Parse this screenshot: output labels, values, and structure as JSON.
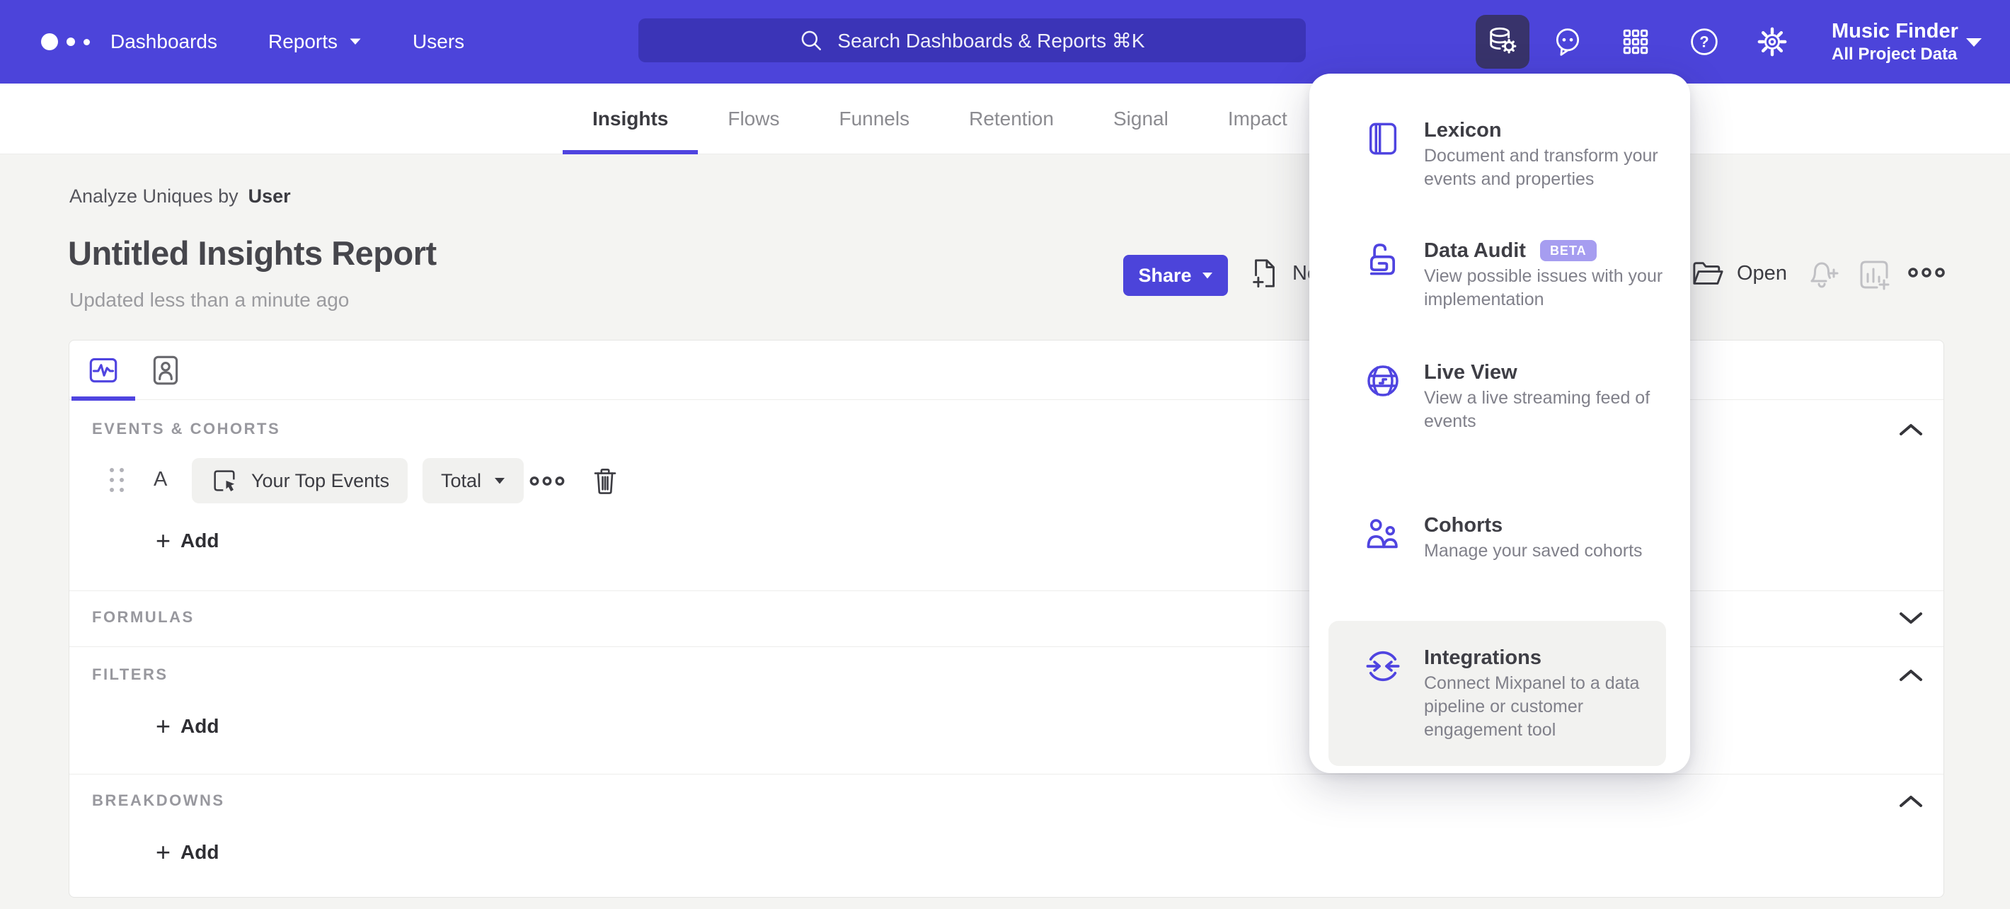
{
  "nav": {
    "items": [
      {
        "label": "Dashboards"
      },
      {
        "label": "Reports"
      },
      {
        "label": "Users"
      }
    ],
    "search_placeholder": "Search Dashboards & Reports ⌘K",
    "project": {
      "name": "Music Finder",
      "scope": "All Project Data"
    },
    "icons": [
      "mixpanel-logo",
      "search-icon",
      "data-management-icon",
      "feedback-icon",
      "apps-grid-icon",
      "help-icon",
      "settings-gear-icon",
      "caret-down-icon"
    ]
  },
  "tabs": {
    "items": [
      {
        "label": "Insights",
        "active": true
      },
      {
        "label": "Flows",
        "active": false
      },
      {
        "label": "Funnels",
        "active": false
      },
      {
        "label": "Retention",
        "active": false
      },
      {
        "label": "Signal",
        "active": false
      },
      {
        "label": "Impact",
        "active": false
      }
    ]
  },
  "report": {
    "analyze_prefix": "Analyze Uniques by",
    "analyze_entity": "User",
    "title": "Untitled Insights Report",
    "updated": "Updated less than a minute ago",
    "share_label": "Share",
    "new_label": "New",
    "open_label": "Open"
  },
  "builder": {
    "events": {
      "label": "EVENTS & COHORTS",
      "row": {
        "letter": "A",
        "event": "Your Top Events",
        "metric": "Total"
      },
      "add_label": "Add"
    },
    "formulas": {
      "label": "FORMULAS"
    },
    "filters": {
      "label": "FILTERS",
      "add_label": "Add"
    },
    "breakdowns": {
      "label": "BREAKDOWNS",
      "add_label": "Add"
    }
  },
  "menu": {
    "items": [
      {
        "title": "Lexicon",
        "desc": "Document and transform your events and properties"
      },
      {
        "title": "Data Audit",
        "badge": "BETA",
        "desc": "View possible issues with your implementation"
      },
      {
        "title": "Live View",
        "desc": "View a live streaming feed of events"
      },
      {
        "title": "Cohorts",
        "desc": "Manage your saved cohorts"
      },
      {
        "title": "Integrations",
        "desc": "Connect Mixpanel to a data pipeline or customer engagement tool",
        "highlighted": true
      }
    ]
  },
  "colors": {
    "nav_purple": "#4c44da",
    "accent_purple": "#4f44e0",
    "active_tile": "#38336b",
    "beta_badge": "#a69df0",
    "page_bg": "#f4f4f2"
  }
}
